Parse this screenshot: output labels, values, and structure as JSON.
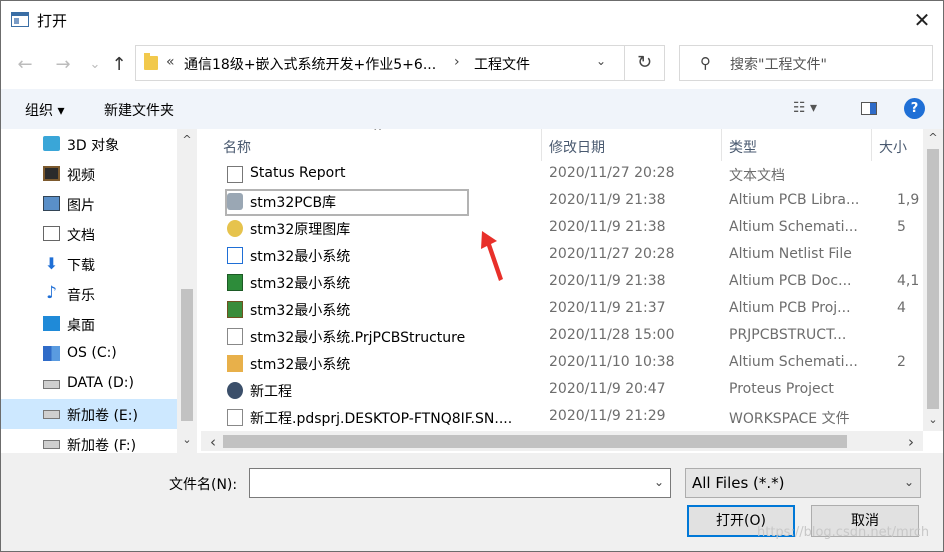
{
  "window": {
    "title": "打开",
    "close_glyph": "✕"
  },
  "nav": {
    "back": "←",
    "forward": "→",
    "recent": "⌄",
    "up": "↑",
    "address": {
      "chevron": "«",
      "segment1": "通信18级+嵌入式系统开发+作业5+6...",
      "arrow": "›",
      "segment2": "工程文件",
      "dropdown": "⌄"
    },
    "refresh": "↻",
    "search": {
      "icon": "⚲",
      "placeholder": "搜索\"工程文件\""
    }
  },
  "toolbar": {
    "organize": "组织 ▾",
    "new_folder": "新建文件夹",
    "view": "☷ ▾",
    "help": "?"
  },
  "sidebar": {
    "items": [
      {
        "label": "3D 对象",
        "icon": "3d-objects-icon"
      },
      {
        "label": "视频",
        "icon": "video-icon"
      },
      {
        "label": "图片",
        "icon": "pictures-icon"
      },
      {
        "label": "文档",
        "icon": "documents-icon"
      },
      {
        "label": "下载",
        "icon": "downloads-icon",
        "glyph": "⬇"
      },
      {
        "label": "音乐",
        "icon": "music-icon",
        "glyph": "♪"
      },
      {
        "label": "桌面",
        "icon": "desktop-icon"
      },
      {
        "label": "OS (C:)",
        "icon": "os-drive-icon"
      },
      {
        "label": "DATA (D:)",
        "icon": "drive-icon"
      },
      {
        "label": "新加卷 (E:)",
        "icon": "drive-icon",
        "selected": true
      },
      {
        "label": "新加卷 (F:)",
        "icon": "drive-icon"
      }
    ]
  },
  "columns": {
    "name": "名称",
    "date": "修改日期",
    "type": "类型",
    "size": "大小",
    "sort_caret": "^"
  },
  "files": [
    {
      "name": "Status Report",
      "date": "2020/11/27 20:28",
      "type": "文本文档",
      "size": "",
      "icon": "text-file-icon"
    },
    {
      "name": "stm32PCB库",
      "date": "2020/11/9 21:38",
      "type": "Altium PCB Libra...",
      "size": "1,9",
      "icon": "pcb-library-icon",
      "focused": true
    },
    {
      "name": "stm32原理图库",
      "date": "2020/11/9 21:38",
      "type": "Altium Schemati...",
      "size": "5",
      "icon": "schematic-library-icon"
    },
    {
      "name": "stm32最小系统",
      "date": "2020/11/27 20:28",
      "type": "Altium Netlist File",
      "size": "",
      "icon": "netlist-icon"
    },
    {
      "name": "stm32最小系统",
      "date": "2020/11/9 21:38",
      "type": "Altium PCB Doc...",
      "size": "4,1",
      "icon": "pcb-document-icon"
    },
    {
      "name": "stm32最小系统",
      "date": "2020/11/9 21:37",
      "type": "Altium PCB Proj...",
      "size": "4",
      "icon": "pcb-project-icon"
    },
    {
      "name": "stm32最小系统.PrjPCBStructure",
      "date": "2020/11/28 15:00",
      "type": "PRJPCBSTRUCT...",
      "size": "",
      "icon": "blank-file-icon"
    },
    {
      "name": "stm32最小系统",
      "date": "2020/11/10 10:38",
      "type": "Altium Schemati...",
      "size": "2",
      "icon": "schematic-document-icon"
    },
    {
      "name": "新工程",
      "date": "2020/11/9 20:47",
      "type": "Proteus Project",
      "size": "",
      "icon": "proteus-project-icon"
    },
    {
      "name": "新工程.pdsprj.DESKTOP-FTNQ8IF.SN....",
      "date": "2020/11/9 21:29",
      "type": "WORKSPACE 文件",
      "size": "",
      "icon": "workspace-file-icon"
    }
  ],
  "scroll": {
    "up": "^",
    "down": "⌄",
    "left": "‹",
    "right": "›"
  },
  "bottom": {
    "filename_label": "文件名(N):",
    "filename_value": "",
    "filetype": "All Files (*.*)",
    "dropdown": "⌄",
    "open": "打开(O)",
    "cancel": "取消"
  },
  "watermark": "https://blog.csdn.net/mrch",
  "colors": {
    "accent": "#0078d7",
    "selected_bg": "#cde8ff",
    "annotation_arrow": "#e8302a"
  }
}
